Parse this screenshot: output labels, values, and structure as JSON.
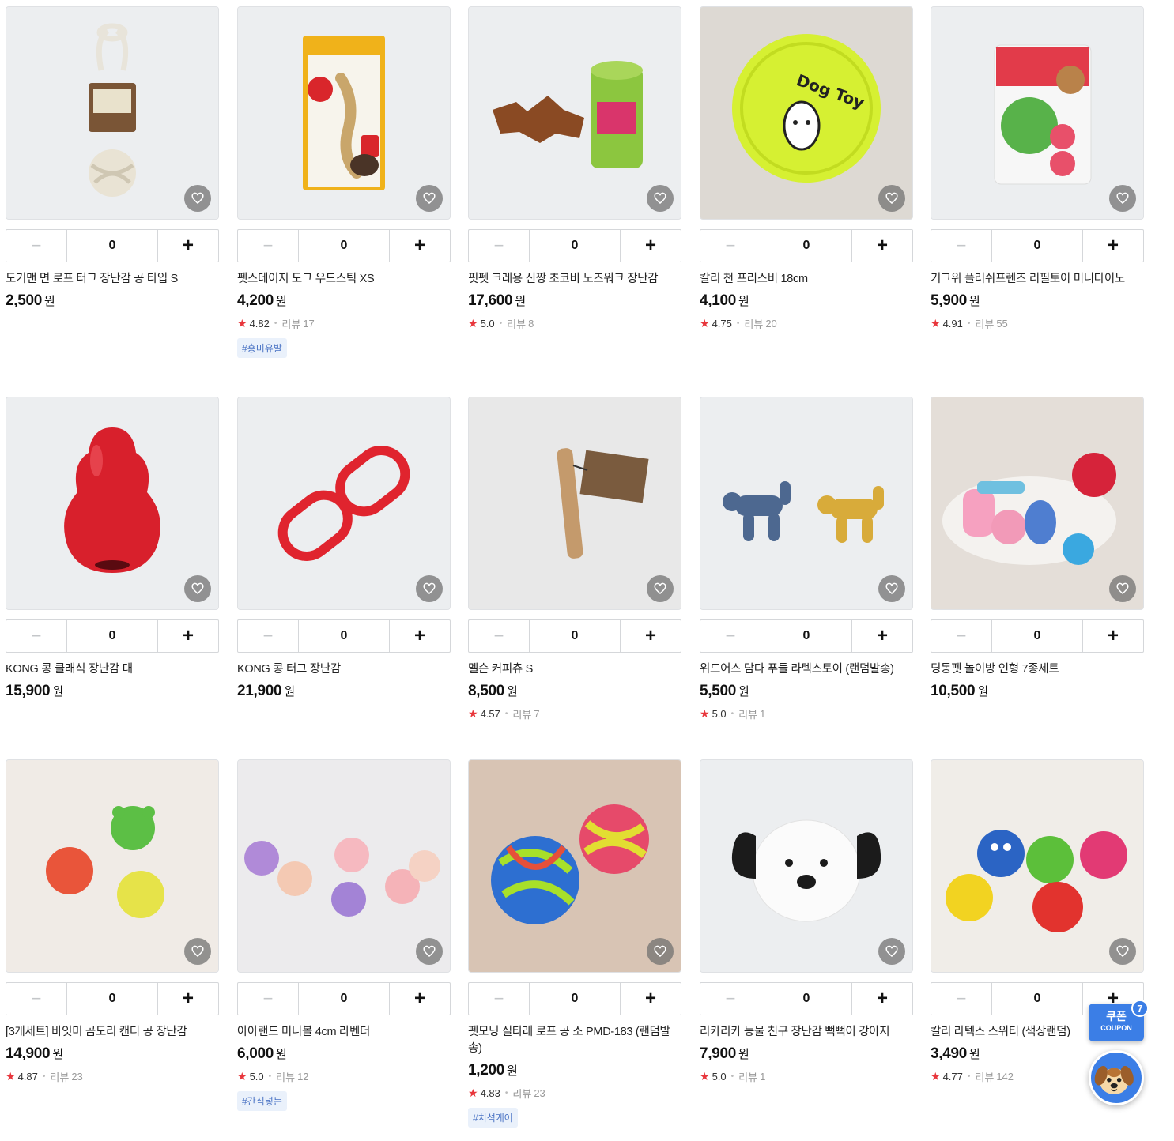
{
  "colors": {
    "accent": "#3b7ee6",
    "star": "#e8363c",
    "tag_text": "#4a73c4",
    "tag_bg": "#eaf1fb"
  },
  "stepper": {
    "minus": "−",
    "plus": "+"
  },
  "currency": "원",
  "review_prefix": "리뷰",
  "products": [
    {
      "name": "도기맨 면 로프 터그 장난감 공 타입 S",
      "price": "2,500",
      "qty": "0"
    },
    {
      "name": "펫스테이지 도그 우드스틱 XS",
      "price": "4,200",
      "qty": "0",
      "rating": "4.82",
      "reviews": "17",
      "tag": "#흥미유발"
    },
    {
      "name": "핏펫 크레용 신짱 초코비 노즈워크 장난감",
      "price": "17,600",
      "qty": "0",
      "rating": "5.0",
      "reviews": "8"
    },
    {
      "name": "칼리 천 프리스비 18cm",
      "price": "4,100",
      "qty": "0",
      "rating": "4.75",
      "reviews": "20"
    },
    {
      "name": "기그위 플러쉬프렌즈 리필토이 미니다이노",
      "price": "5,900",
      "qty": "0",
      "rating": "4.91",
      "reviews": "55"
    },
    {
      "name": "KONG 콩 클래식 장난감 대",
      "price": "15,900",
      "qty": "0"
    },
    {
      "name": "KONG 콩 터그 장난감",
      "price": "21,900",
      "qty": "0"
    },
    {
      "name": "멜슨 커피츄 S",
      "price": "8,500",
      "qty": "0",
      "rating": "4.57",
      "reviews": "7"
    },
    {
      "name": "위드어스 담다 푸들 라텍스토이 (랜덤발송)",
      "price": "5,500",
      "qty": "0",
      "rating": "5.0",
      "reviews": "1"
    },
    {
      "name": "딩동펫 놀이방 인형 7종세트",
      "price": "10,500",
      "qty": "0"
    },
    {
      "name": "[3개세트] 바잇미 곰도리 캔디 공 장난감",
      "price": "14,900",
      "qty": "0",
      "rating": "4.87",
      "reviews": "23"
    },
    {
      "name": "아아랜드 미니볼 4cm 라벤더",
      "price": "6,000",
      "qty": "0",
      "rating": "5.0",
      "reviews": "12",
      "tag": "#간식넣는"
    },
    {
      "name": "펫모닝 실타래 로프 공 소 PMD-183 (랜덤발송)",
      "price": "1,200",
      "qty": "0",
      "rating": "4.83",
      "reviews": "23",
      "tag": "#치석케어"
    },
    {
      "name": "리카리카 동물 친구 장난감 뻑뻑이 강아지",
      "price": "7,900",
      "qty": "0",
      "rating": "5.0",
      "reviews": "1"
    },
    {
      "name": "칼리 라텍스 스위티 (색상랜덤)",
      "price": "3,490",
      "qty": "0",
      "rating": "4.77",
      "reviews": "142"
    }
  ],
  "coupon": {
    "label": "쿠폰",
    "sub": "COUPON",
    "count": "7"
  }
}
